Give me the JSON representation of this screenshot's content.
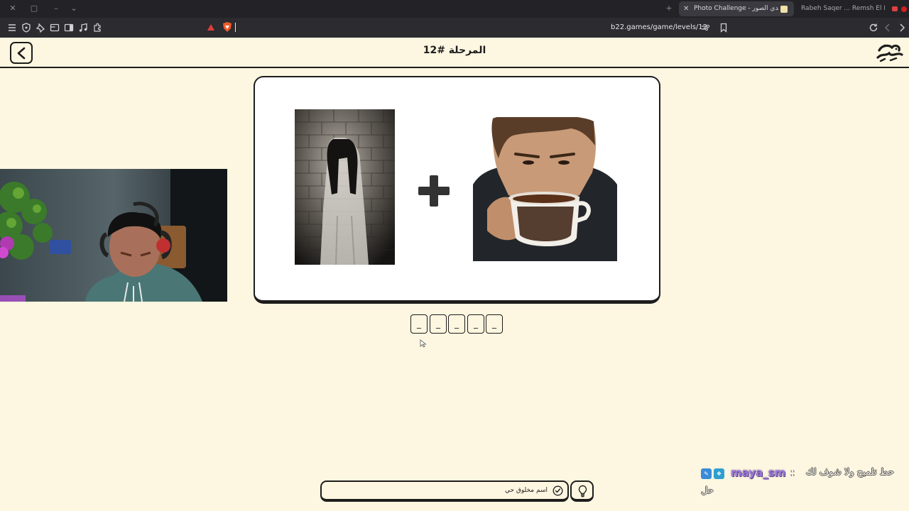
{
  "browser": {
    "tabs": [
      {
        "title": "Photo Challenge - لعبة تحدي الصور",
        "active": true
      },
      {
        "title": "Rabeh Saqer ... Remsh El Maha | ..."
      }
    ],
    "url": "b22.games/game/levels/12"
  },
  "header": {
    "title": "المرحلة #12",
    "logo_text": "تحدي الصور"
  },
  "puzzle": {
    "plus_symbol": "+",
    "left_image": "ghost-woman-against-brick-wall",
    "right_image": "man-drinking-coffee",
    "slots": [
      "_",
      "_",
      "_",
      "_",
      "_"
    ]
  },
  "hint": {
    "text": "اسم مخلوق حي",
    "check_icon": "check-circle-icon",
    "bulb_icon": "lightbulb-icon"
  },
  "chat": {
    "username": "maya_sm",
    "separator": ":",
    "message": "حط تلميح ولا شوف لك",
    "message_line2": "حل"
  },
  "colors": {
    "page_bg": "#fdf6e0",
    "ink": "#1d1d1d",
    "card_bg": "#ffffff",
    "chrome_dark": "#232327"
  }
}
